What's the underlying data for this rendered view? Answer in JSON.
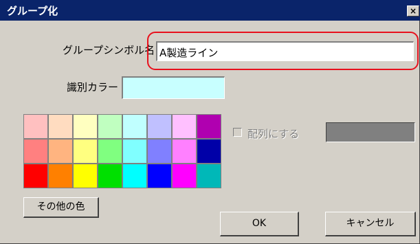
{
  "window": {
    "title": "グループ化",
    "close_glyph": "×"
  },
  "group_name": {
    "label": "グループシンボル名",
    "value": "A製造ライン"
  },
  "identify_color": {
    "label": "識別カラー",
    "value_color": "#c8ffff"
  },
  "palette": {
    "colors": [
      "#ffc0c0",
      "#ffdcc0",
      "#ffffc0",
      "#c0ffc0",
      "#c0ffff",
      "#c0c0ff",
      "#ffc0ff",
      "#b000b0",
      "#ff8080",
      "#ffb480",
      "#ffff80",
      "#80ff80",
      "#80ffff",
      "#8080ff",
      "#ff80ff",
      "#0000a8",
      "#ff0000",
      "#ff8000",
      "#ffff00",
      "#00e000",
      "#00ffff",
      "#0000ff",
      "#ff00ff",
      "#00b8b8"
    ]
  },
  "array_option": {
    "label": "配列にする",
    "checked": false,
    "enabled": false
  },
  "buttons": {
    "other_color": "その他の色",
    "ok": "OK",
    "cancel": "キャンセル"
  },
  "colors": {
    "titlebar": "#0a246a",
    "dialog": "#d4d0c8",
    "highlight": "#e8101c"
  }
}
